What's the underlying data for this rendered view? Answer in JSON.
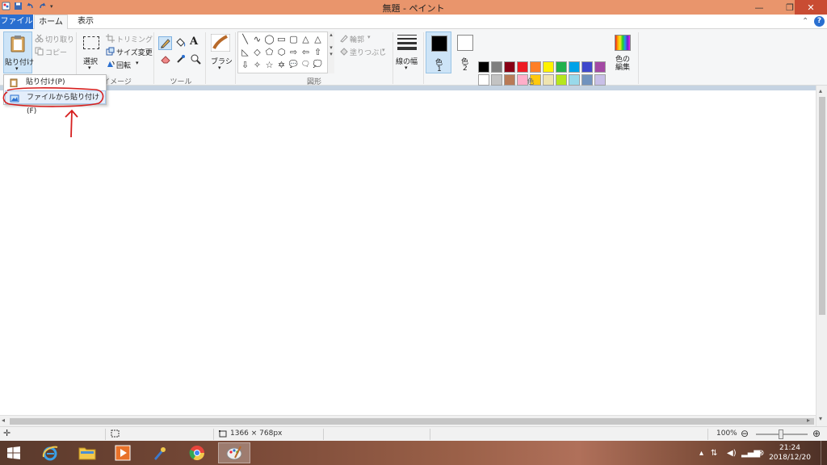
{
  "window": {
    "title": "無題 - ペイント",
    "minimize": "—",
    "maximize": "❐",
    "close": "✕"
  },
  "tabs": {
    "file": "ファイル",
    "home": "ホーム",
    "view": "表示",
    "help": "?"
  },
  "clipboard": {
    "paste": "貼り付け",
    "cut": "切り取り",
    "copy": "コピー"
  },
  "image": {
    "select": "選択",
    "crop": "トリミング",
    "resize": "サイズ変更",
    "rotate": "回転",
    "group_label": "イメージ"
  },
  "tools": {
    "group_label": "ツール"
  },
  "brush": {
    "label": "ブラシ"
  },
  "shapes": {
    "group_label": "図形",
    "outline": "輪郭",
    "fill": "塗りつぶし",
    "items": [
      "╲",
      "∿",
      "◯",
      "▭",
      "▢",
      "△",
      "◺",
      "◇",
      "⬠",
      "⬡",
      "⇨",
      "⇦",
      "⇧",
      "⇩",
      "✧",
      "☆",
      "✡",
      "💬",
      "🗨",
      "💭"
    ]
  },
  "size": {
    "label": "線の幅"
  },
  "colors": {
    "color1_label": "色",
    "color1_num": "1",
    "color2_label": "色",
    "color2_num": "2",
    "group_label": "色",
    "edit_label": "色の編集",
    "color1_value": "#000000",
    "color2_value": "#ffffff",
    "palette_row1": [
      "#000000",
      "#7f7f7f",
      "#880015",
      "#ed1c24",
      "#ff7f27",
      "#fff200",
      "#22b14c",
      "#00a2e8",
      "#3f48cc",
      "#a349a4"
    ],
    "palette_row2": [
      "#ffffff",
      "#c3c3c3",
      "#b97a57",
      "#ffaec9",
      "#ffc90e",
      "#efe4b0",
      "#b5e61d",
      "#99d9ea",
      "#7092be",
      "#c8bfe7"
    ],
    "palette_row3": [
      "#ffffff",
      "#ffffff",
      "#ffffff",
      "#ffffff",
      "#ffffff",
      "#ffffff",
      "#ffffff",
      "#ffffff",
      "#ffffff",
      "#ffffff"
    ]
  },
  "paste_menu": {
    "item1": "貼り付け(P)",
    "item2": "ファイルから貼り付け(F)"
  },
  "status": {
    "canvas_size": "1366 × 768px",
    "zoom": "100%",
    "zoom_out": "⊖",
    "zoom_in": "⊕"
  },
  "taskbar": {
    "time": "21:24",
    "date": "2018/12/20"
  }
}
